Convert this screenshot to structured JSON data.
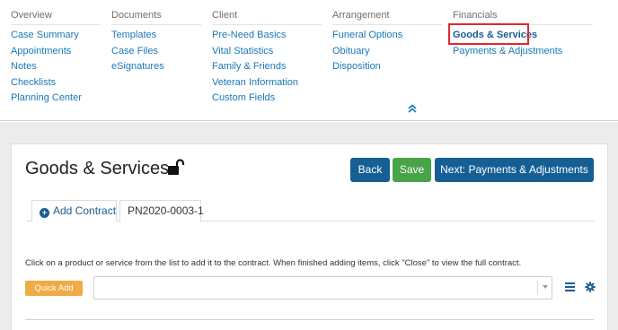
{
  "nav": {
    "columns": [
      {
        "header": "Overview",
        "links": [
          "Case Summary",
          "Appointments",
          "Notes",
          "Checklists",
          "Planning Center"
        ]
      },
      {
        "header": "Documents",
        "links": [
          "Templates",
          "Case Files",
          "eSignatures"
        ]
      },
      {
        "header": "Client",
        "links": [
          "Pre-Need Basics",
          "Vital Statistics",
          "Family & Friends",
          "Veteran Information",
          "Custom Fields"
        ]
      },
      {
        "header": "Arrangement",
        "links": [
          "Funeral Options",
          "Obituary",
          "Disposition"
        ]
      },
      {
        "header": "Financials",
        "links": [
          "Goods & Services",
          "Payments & Adjustments"
        ]
      }
    ],
    "active_link": "Goods & Services",
    "collapse_icon": "chevrons-up-icon"
  },
  "page": {
    "title": "Goods & Services",
    "title_icon": "unlock-icon"
  },
  "buttons": {
    "back": "Back",
    "save": "Save",
    "next": "Next: Payments & Adjustments"
  },
  "tabs": {
    "add_contract": "Add Contract",
    "contract": "PN2020-0003-1"
  },
  "instructions": "Click on a product or service from the list to add it to the contract. When finished adding items, click \"Close\" to view the full contract.",
  "quick_add": {
    "label": "Quick Add",
    "select_value": ""
  },
  "colors": {
    "link": "#1a78b8",
    "primary": "#155f95",
    "success": "#49a347",
    "warning": "#efab45",
    "highlight_border": "#e0282e"
  }
}
